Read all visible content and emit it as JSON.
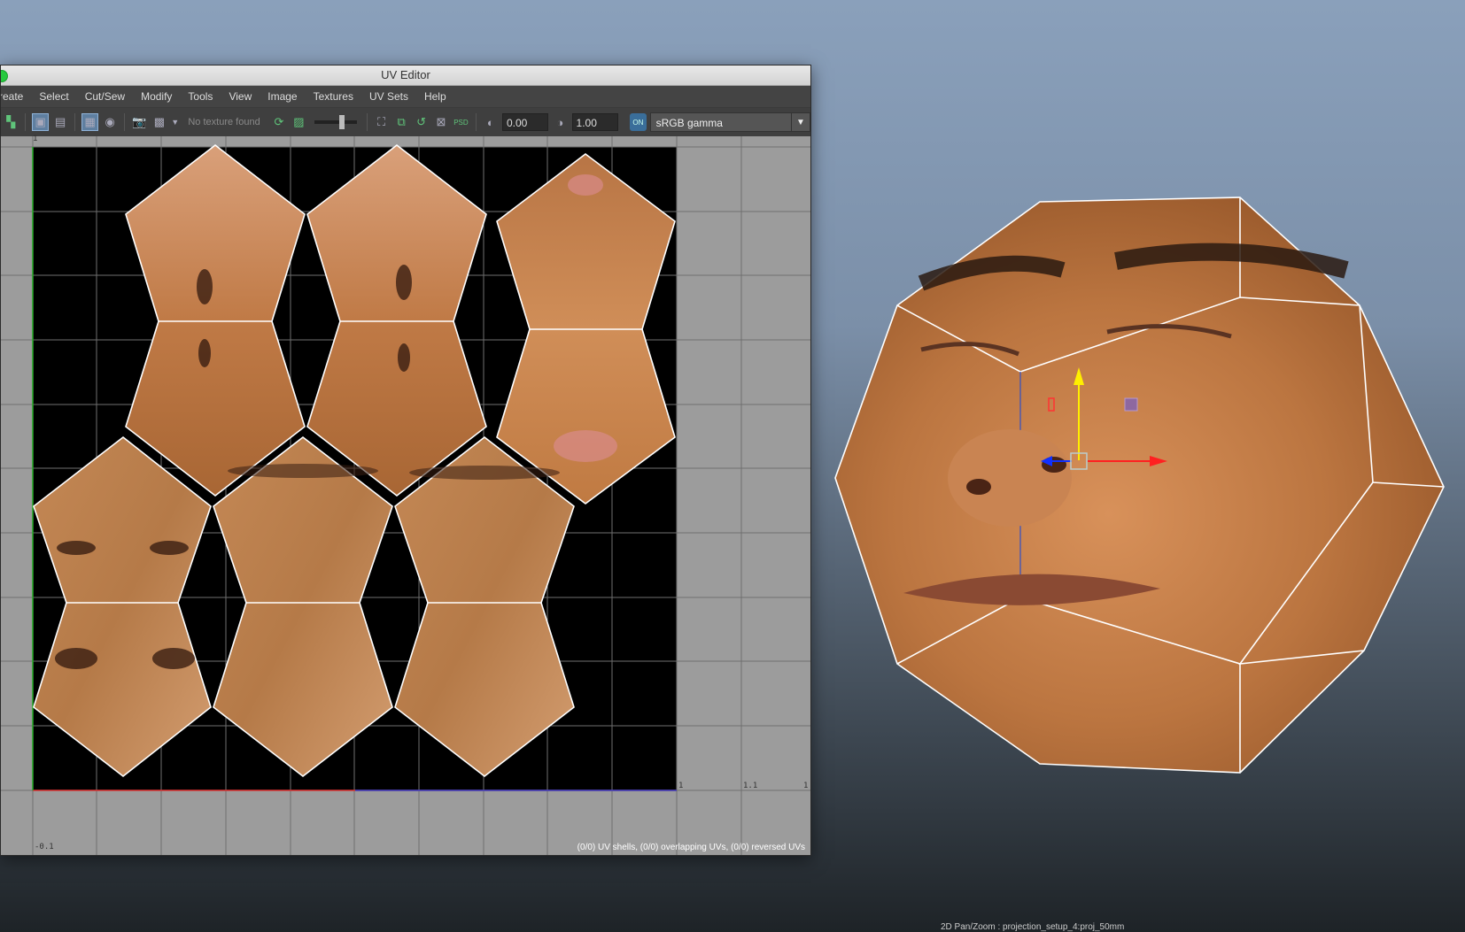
{
  "window": {
    "title": "UV Editor"
  },
  "menu": [
    "reate",
    "Select",
    "Cut/Sew",
    "Modify",
    "Tools",
    "View",
    "Image",
    "Textures",
    "UV Sets",
    "Help"
  ],
  "toolbar": {
    "texture_status": "No texture found",
    "exposure": "0.00",
    "gamma": "1.00",
    "color_space": "sRGB gamma"
  },
  "uv_grid": {
    "tick_top_left": "1",
    "tick_right_1": "1",
    "tick_right_2": "1.1",
    "tick_right_3": "1",
    "tick_bottom_left": "-0.1"
  },
  "status_bar": "(0/0) UV shells, (0/0) overlapping UVs, (0/0) reversed UVs",
  "viewport_hud": "2D Pan/Zoom : projection_setup_4:proj_50mm",
  "colors": {
    "skin": "#c9834c",
    "uv_background": "#000000",
    "grid_outside": "#9c9c9c",
    "manip_x": "#ff2020",
    "manip_y": "#ffee00",
    "manip_z": "#1030ff"
  }
}
